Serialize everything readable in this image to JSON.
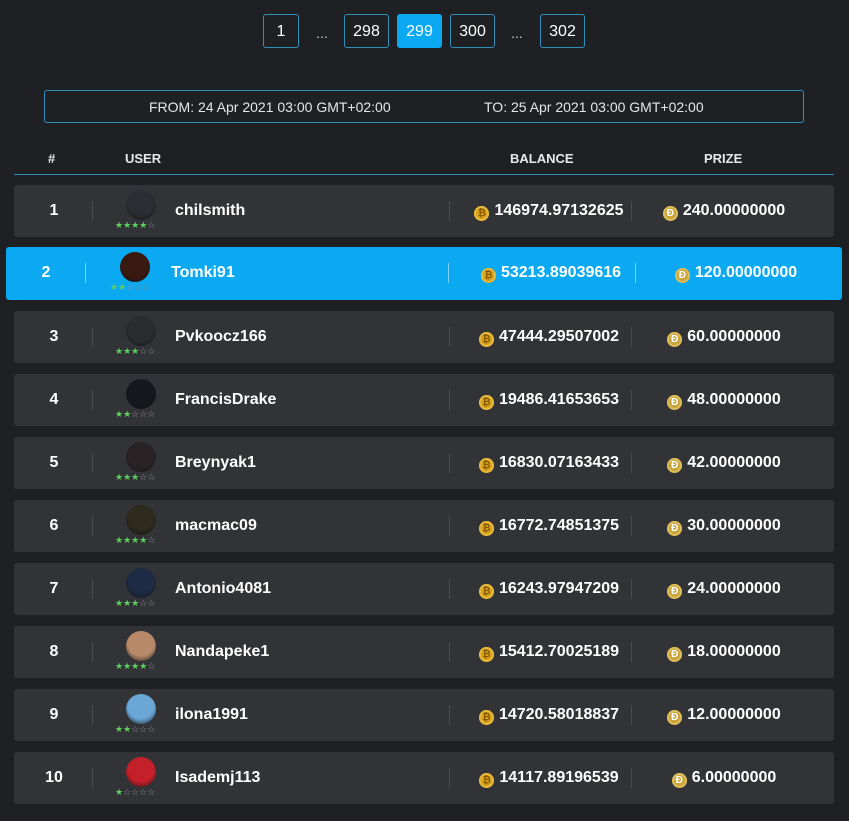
{
  "pagination": {
    "pages": [
      "1",
      "298",
      "299",
      "300",
      "302"
    ],
    "active": "299",
    "ellipsis": "..."
  },
  "range": {
    "from": "FROM: 24 Apr 2021 03:00 GMT+02:00",
    "to": "TO: 25 Apr 2021 03:00 GMT+02:00"
  },
  "table": {
    "headers": {
      "rank": "#",
      "user": "USER",
      "balance": "BALANCE",
      "prize": "PRIZE"
    },
    "rows": [
      {
        "rank": "1",
        "user": "chilsmith",
        "stars": 4,
        "balance": "146974.97132625",
        "prize": "240.00000000",
        "highlight": false,
        "avatar_color": "#2a2d33"
      },
      {
        "rank": "2",
        "user": "Tomki91",
        "stars": 2,
        "balance": "53213.89039616",
        "prize": "120.00000000",
        "highlight": true,
        "avatar_color": "#3a1a10"
      },
      {
        "rank": "3",
        "user": "Pvkoocz166",
        "stars": 3,
        "balance": "47444.29507002",
        "prize": "60.00000000",
        "highlight": false,
        "avatar_color": "#2b2c30"
      },
      {
        "rank": "4",
        "user": "FrancisDrake",
        "stars": 2,
        "balance": "19486.41653653",
        "prize": "48.00000000",
        "highlight": false,
        "avatar_color": "#15181c"
      },
      {
        "rank": "5",
        "user": "Breynyak1",
        "stars": 3,
        "balance": "16830.07163433",
        "prize": "42.00000000",
        "highlight": false,
        "avatar_color": "#2a2326"
      },
      {
        "rank": "6",
        "user": "macmac09",
        "stars": 4,
        "balance": "16772.74851375",
        "prize": "30.00000000",
        "highlight": false,
        "avatar_color": "#2e2a1e"
      },
      {
        "rank": "7",
        "user": "Antonio4081",
        "stars": 3,
        "balance": "16243.97947209",
        "prize": "24.00000000",
        "highlight": false,
        "avatar_color": "#1d2b44"
      },
      {
        "rank": "8",
        "user": "Nandapeke1",
        "stars": 4,
        "balance": "15412.70025189",
        "prize": "18.00000000",
        "highlight": false,
        "avatar_color": "#b88a6a"
      },
      {
        "rank": "9",
        "user": "ilona1991",
        "stars": 2,
        "balance": "14720.58018837",
        "prize": "12.00000000",
        "highlight": false,
        "avatar_color": "#6aa6d6"
      },
      {
        "rank": "10",
        "user": "Isademj113",
        "stars": 1,
        "balance": "14117.89196539",
        "prize": "6.00000000",
        "highlight": false,
        "avatar_color": "#c4202a"
      }
    ]
  },
  "colors": {
    "accent": "#0aa9f2",
    "row_bg": "#323337",
    "page_bg": "#1f2023",
    "star_on": "#5fcf5f",
    "coin": "#d5a21a"
  },
  "icons": {
    "balance": "coin-icon",
    "prize": "dogecoin-icon",
    "rating": "star-icon"
  }
}
